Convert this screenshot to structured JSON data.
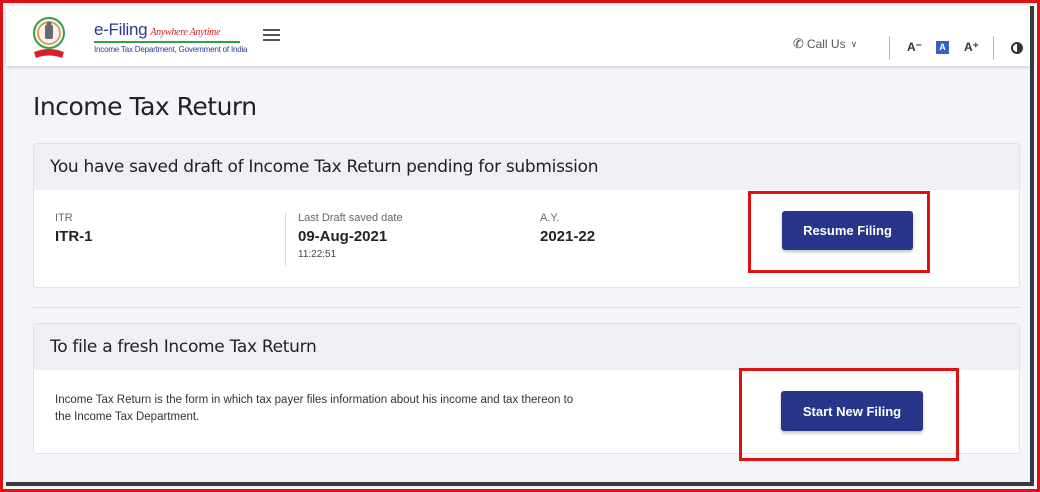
{
  "header": {
    "brand_title": "e-Filing",
    "brand_tagline": "Anywhere Anytime",
    "brand_subtitle": "Income Tax Department, Government of India",
    "call_us_label": "Call Us",
    "font_decrease": "A⁻",
    "font_default": "A",
    "font_increase": "A⁺",
    "icons": [
      "emblem-logo",
      "hamburger-menu-icon",
      "phone-icon",
      "chevron-down-icon",
      "contrast-icon"
    ]
  },
  "page": {
    "title": "Income Tax Return"
  },
  "draft_card": {
    "heading": "You have saved draft of Income Tax Return pending for submission",
    "itr_label": "ITR",
    "itr_value": "ITR-1",
    "date_label": "Last Draft saved date",
    "date_value": "09-Aug-2021",
    "time_value": "11:22:51",
    "ay_label": "A.Y.",
    "ay_value": "2021-22",
    "button_label": "Resume Filing"
  },
  "fresh_card": {
    "heading": "To file a fresh Income Tax Return",
    "description": "Income Tax Return is the form in which tax payer files information about his income and tax thereon to the Income Tax Department.",
    "button_label": "Start New Filing"
  },
  "colors": {
    "primary_button": "#27358a",
    "highlight_border": "#e01010",
    "brand_blue": "#2a3a8c",
    "brand_red": "#d4202a"
  }
}
